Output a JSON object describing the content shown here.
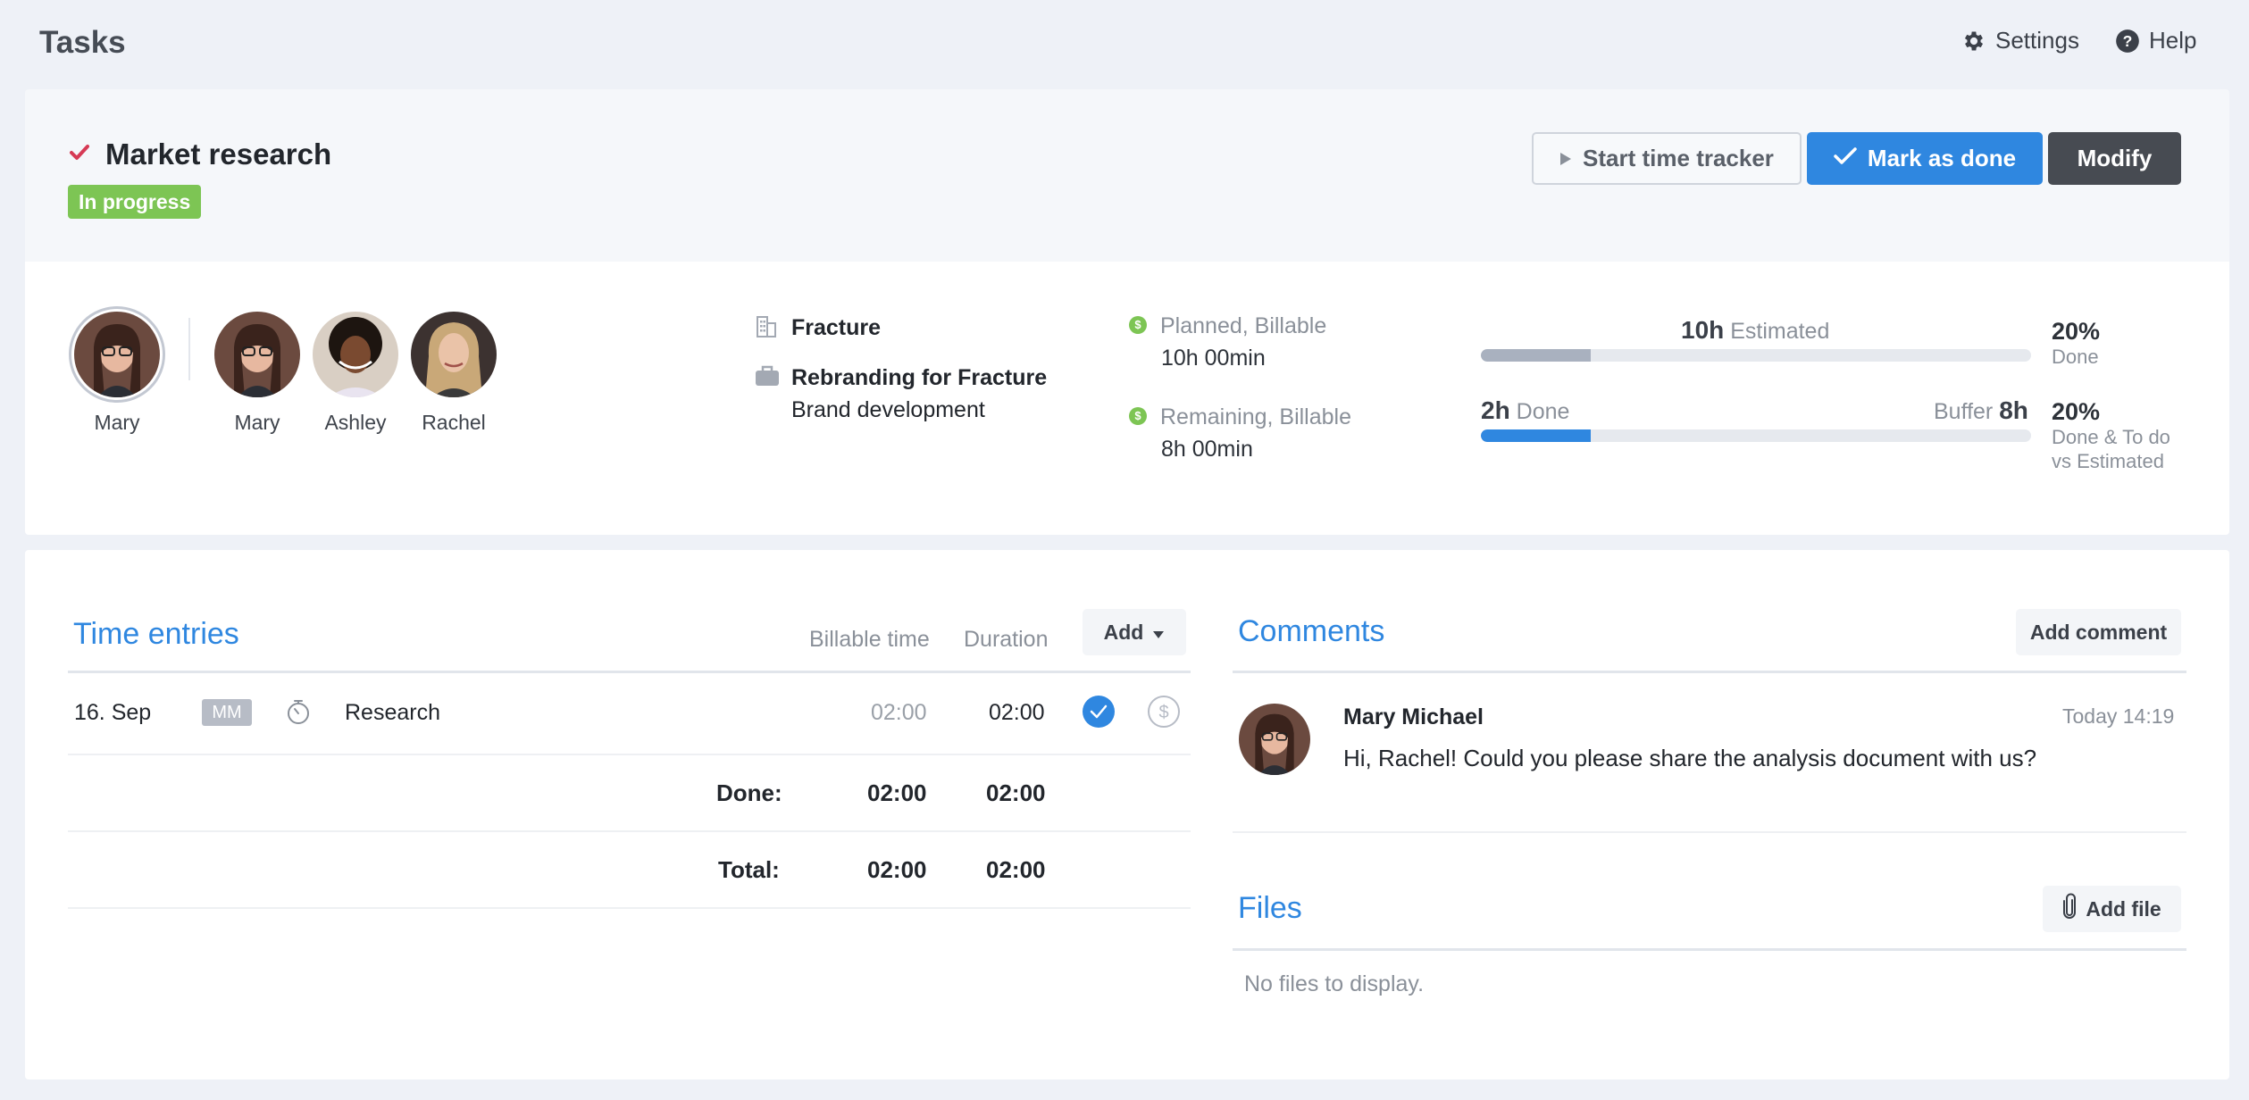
{
  "header": {
    "title": "Tasks",
    "settings_label": "Settings",
    "help_label": "Help"
  },
  "task": {
    "title": "Market research",
    "status": "In progress",
    "buttons": {
      "start_tracker": "Start time tracker",
      "mark_done": "Mark as done",
      "modify": "Modify"
    }
  },
  "people": {
    "owner": "Mary",
    "assignees": [
      "Mary",
      "Ashley",
      "Rachel"
    ]
  },
  "project": {
    "client": "Fracture",
    "project_name": "Rebranding for Fracture",
    "service": "Brand development"
  },
  "budget": {
    "planned_label": "Planned, Billable",
    "planned_value": "10h 00min",
    "remaining_label": "Remaining, Billable",
    "remaining_value": "8h 00min",
    "estimated_value": "10h",
    "estimated_label": "Estimated",
    "done_value": "2h",
    "done_label": "Done",
    "buffer_label": "Buffer",
    "buffer_value": "8h",
    "estimated_progress": 0.2,
    "done_progress": 0.2,
    "pct_done": "20%",
    "pct_done_label": "Done",
    "pct_todo": "20%",
    "pct_todo_label_1": "Done & To do",
    "pct_todo_label_2": "vs Estimated"
  },
  "time_entries": {
    "title": "Time entries",
    "col_billable": "Billable time",
    "col_duration": "Duration",
    "add_label": "Add",
    "rows": [
      {
        "date": "16. Sep",
        "user": "MM",
        "description": "Research",
        "billable": "02:00",
        "duration": "02:00"
      }
    ],
    "done_label": "Done:",
    "done_billable": "02:00",
    "done_duration": "02:00",
    "total_label": "Total:",
    "total_billable": "02:00",
    "total_duration": "02:00"
  },
  "comments": {
    "title": "Comments",
    "add_label": "Add comment",
    "items": [
      {
        "author": "Mary Michael",
        "time": "Today 14:19",
        "text": "Hi, Rachel! Could you please share the analysis document with us?"
      }
    ]
  },
  "files": {
    "title": "Files",
    "add_label": "Add file",
    "empty": "No files to display."
  },
  "colors": {
    "accent": "#2f87e0",
    "status_green": "#7dc554",
    "dark_button": "#474b52",
    "check_red": "#d63a55"
  }
}
